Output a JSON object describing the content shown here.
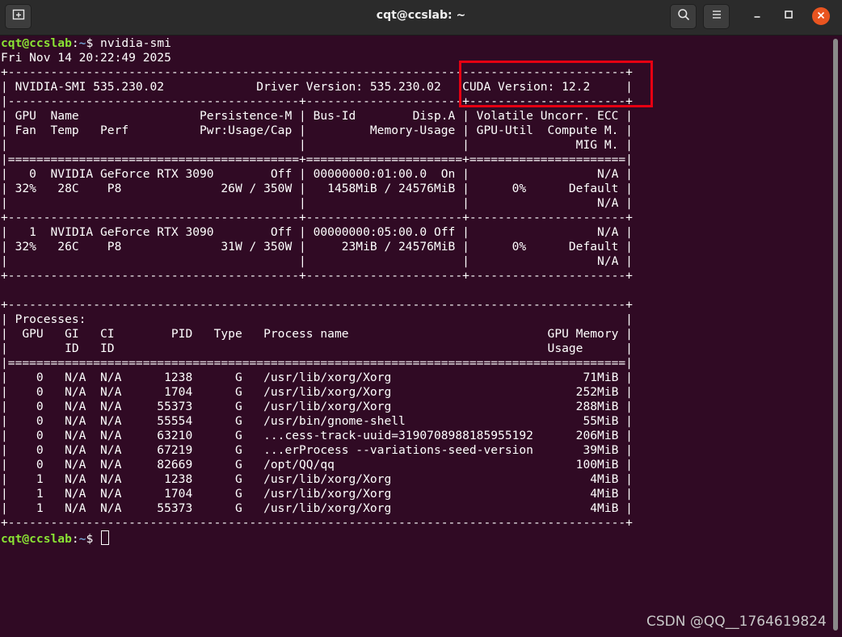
{
  "window": {
    "title": "cqt@ccslab: ~",
    "new_tab_icon": "new-tab-icon",
    "search_icon": "search-icon",
    "menu_icon": "hamburger-menu-icon",
    "minimize_icon": "minimize-icon",
    "maximize_icon": "maximize-icon",
    "close_icon": "close-icon"
  },
  "prompt": {
    "user_host": "cqt@ccslab",
    "sep": ":",
    "path": "~",
    "symbol": "$ "
  },
  "command": "nvidia-smi",
  "output": {
    "timestamp": "Fri Nov 14 20:22:49 2025",
    "header": [
      "+---------------------------------------------------------------------------------------+",
      "| NVIDIA-SMI 535.230.02             Driver Version: 535.230.02   CUDA Version: 12.2     |",
      "|-----------------------------------------+----------------------+----------------------+",
      "| GPU  Name                 Persistence-M | Bus-Id        Disp.A | Volatile Uncorr. ECC |",
      "| Fan  Temp   Perf          Pwr:Usage/Cap |         Memory-Usage | GPU-Util  Compute M. |",
      "|                                         |                      |               MIG M. |",
      "|=========================================+======================+======================|"
    ],
    "gpus": [
      {
        "rows": [
          "|   0  NVIDIA GeForce RTX 3090        Off | 00000000:01:00.0  On |                  N/A |",
          "| 32%   28C    P8              26W / 350W |   1458MiB / 24576MiB |      0%      Default |",
          "|                                         |                      |                  N/A |"
        ],
        "separator": "+-----------------------------------------+----------------------+----------------------+"
      },
      {
        "rows": [
          "|   1  NVIDIA GeForce RTX 3090        Off | 00000000:05:00.0 Off |                  N/A |",
          "| 32%   26C    P8              31W / 350W |     23MiB / 24576MiB |      0%      Default |",
          "|                                         |                      |                  N/A |"
        ],
        "separator": "+-----------------------------------------+----------------------+----------------------+"
      }
    ],
    "blank": "",
    "processes_header": [
      "+---------------------------------------------------------------------------------------+",
      "| Processes:                                                                            |",
      "|  GPU   GI   CI        PID   Type   Process name                            GPU Memory |",
      "|        ID   ID                                                             Usage      |",
      "|=======================================================================================|"
    ],
    "processes": [
      "|    0   N/A  N/A      1238      G   /usr/lib/xorg/Xorg                           71MiB |",
      "|    0   N/A  N/A      1704      G   /usr/lib/xorg/Xorg                          252MiB |",
      "|    0   N/A  N/A     55373      G   /usr/lib/xorg/Xorg                          288MiB |",
      "|    0   N/A  N/A     55554      G   /usr/bin/gnome-shell                         55MiB |",
      "|    0   N/A  N/A     63210      G   ...cess-track-uuid=3190708988185955192      206MiB |",
      "|    0   N/A  N/A     67219      G   ...erProcess --variations-seed-version       39MiB |",
      "|    0   N/A  N/A     82669      G   /opt/QQ/qq                                  100MiB |",
      "|    1   N/A  N/A      1238      G   /usr/lib/xorg/Xorg                            4MiB |",
      "|    1   N/A  N/A      1704      G   /usr/lib/xorg/Xorg                            4MiB |",
      "|    1   N/A  N/A     55373      G   /usr/lib/xorg/Xorg                            4MiB |"
    ],
    "footer": "+---------------------------------------------------------------------------------------+"
  },
  "annotation": {
    "color": "#e60012"
  },
  "watermark": "CSDN @QQ__1764619824",
  "colors": {
    "background": "#300a24",
    "titlebar": "#2b2b2b",
    "prompt_user": "#8ae234",
    "prompt_path": "#729fcf",
    "close_button": "#e95420"
  }
}
